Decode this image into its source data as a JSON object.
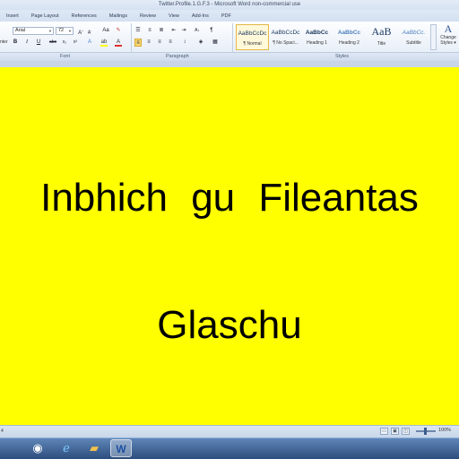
{
  "window": {
    "title": "Twitter.Profile.1.G.F.3 - Microsoft Word non-commercial use"
  },
  "ribbon": {
    "tabs": [
      "Insert",
      "Page Layout",
      "References",
      "Mailings",
      "Review",
      "View",
      "Add-Ins",
      "PDF"
    ],
    "paste_stub": "nter",
    "font": {
      "name": "Arial",
      "size": "72"
    },
    "groups": {
      "font": "Font",
      "paragraph": "Paragraph",
      "styles": "Styles"
    },
    "styles": [
      {
        "sample": "AaBbCcDc",
        "name": "¶ Normal"
      },
      {
        "sample": "AaBbCcDc",
        "name": "¶ No Spaci..."
      },
      {
        "sample": "AaBbCc",
        "name": "Heading 1"
      },
      {
        "sample": "AaBbCc",
        "name": "Heading 2"
      },
      {
        "sample": "AaB",
        "name": "Title"
      },
      {
        "sample": "AaBbCc.",
        "name": "Subtitle"
      }
    ],
    "change_styles": [
      "Change",
      "Styles ▾"
    ]
  },
  "document": {
    "background_color": "#ffff00",
    "line1": "Inbhich  gu  Fileantas",
    "line2": "Glaschu"
  },
  "status": {
    "left": "4",
    "zoom": "100%"
  }
}
